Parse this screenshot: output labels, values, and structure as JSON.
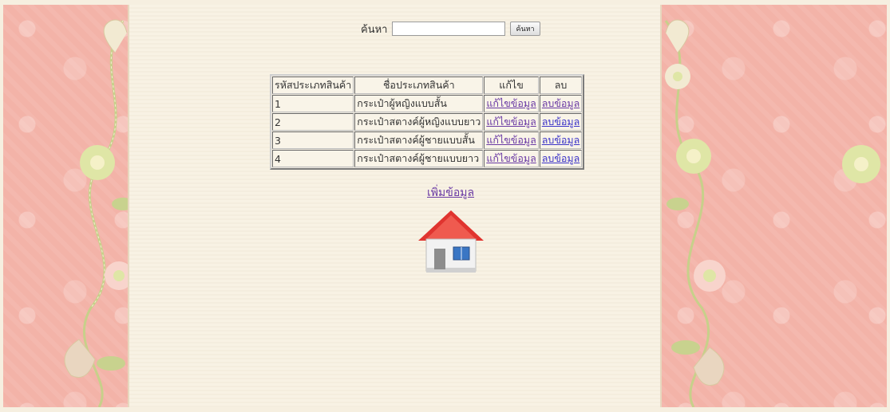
{
  "search": {
    "label": "ค้นหา",
    "value": "",
    "button_label": "ค้นหา"
  },
  "table": {
    "headers": [
      "รหัสประเภทสินค้า",
      "ชื่อประเภทสินค้า",
      "แก้ไข",
      "ลบ"
    ],
    "rows": [
      {
        "id": "1",
        "name": "กระเป๋าผู้หญิงแบบสั้น",
        "edit": "แก้ไขข้อมูล",
        "delete": "ลบข้อมูล"
      },
      {
        "id": "2",
        "name": "กระเป๋าสตางค์ผู้หญิงแบบยาว",
        "edit": "แก้ไขข้อมูล",
        "delete": "ลบข้อมูล"
      },
      {
        "id": "3",
        "name": "กระเป๋าสตางค์ผู้ชายแบบสั้น",
        "edit": "แก้ไขข้อมูล",
        "delete": "ลบข้อมูล"
      },
      {
        "id": "4",
        "name": "กระเป๋าสตางค์ผู้ชายแบบยาว",
        "edit": "แก้ไขข้อมูล",
        "delete": "ลบข้อมูล"
      }
    ]
  },
  "add_link": "เพิ่มข้อมูล",
  "icons": {
    "home": "home-icon"
  },
  "colors": {
    "side_panel": "#f3b3a8",
    "center_panel": "#f8f2e4",
    "link_unvisited": "#3b33c8",
    "link_visited": "#6a3aa4"
  }
}
